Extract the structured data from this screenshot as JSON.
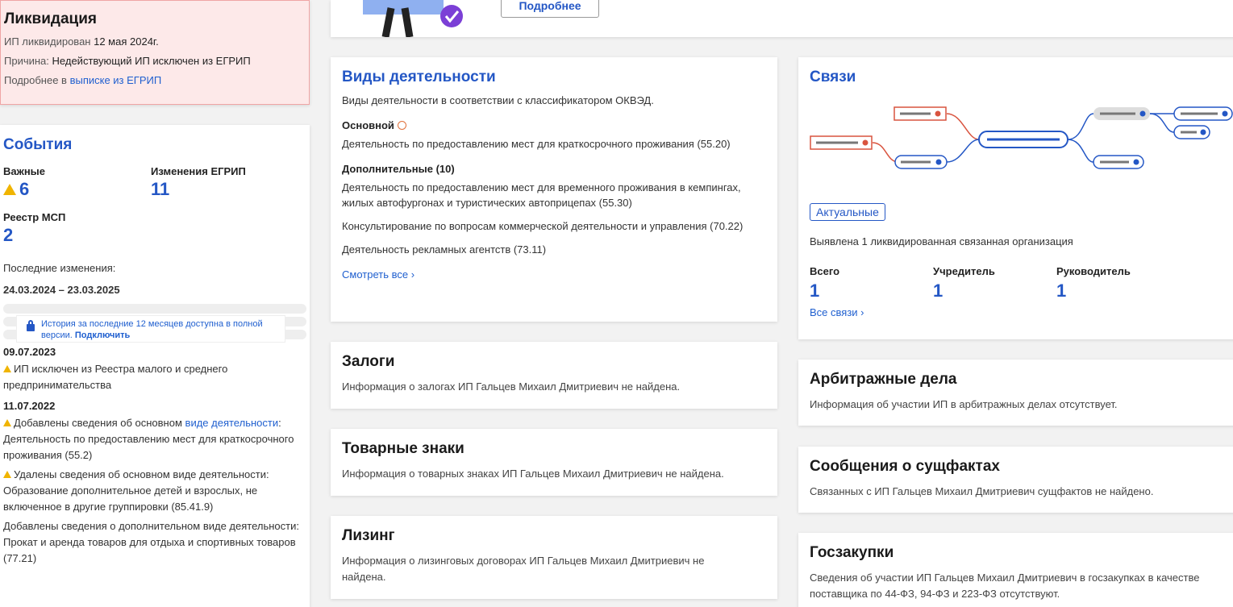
{
  "liquidation": {
    "title": "Ликвидация",
    "line1_label": "ИП ликвидирован",
    "line1_value": "12 мая 2024г.",
    "line2_label": "Причина:",
    "line2_value": "Недействующий ИП исключен из ЕГРИП",
    "line3_label": "Подробнее в",
    "line3_link": "выписке из ЕГРИП"
  },
  "events": {
    "title": "События",
    "stats": [
      {
        "label": "Важные",
        "value": "6"
      },
      {
        "label": "Изменения ЕГРИП",
        "value": "11"
      },
      {
        "label": "Реестр МСП",
        "value": "2"
      }
    ],
    "recent_label": "Последние изменения:",
    "range": "24.03.2024 – 23.03.2025",
    "lock_text": "История за последние 12 месяцев доступна в полной версии.",
    "lock_link": "Подключить",
    "items": [
      {
        "date": "09.07.2023",
        "text": "ИП исключен из Реестра малого и среднего предпринимательства"
      },
      {
        "date": "11.07.2022",
        "text_a": "Добавлены сведения об основном",
        "link": "виде деятельности",
        "text_b": ": Деятельность по предоставлению мест для краткосрочного проживания (55.2)"
      },
      {
        "text": "Удалены сведения об основном виде деятельности: Образование дополнительное детей и взрослых, не включенное в другие группировки (85.41.9)"
      },
      {
        "text": "Добавлены сведения о дополнительном виде деятельности: Прокат и аренда товаров для отдыха и спортивных товаров (77.21)"
      }
    ]
  },
  "banner": {
    "button": "Подробнее"
  },
  "activities": {
    "title": "Виды деятельности",
    "subtitle": "Виды деятельности в соответствии с классификатором ОКВЭД.",
    "main_label": "Основной",
    "main_item": "Деятельность по предоставлению мест для краткосрочного проживания (55.20)",
    "extra_label": "Дополнительные (10)",
    "extra_items": [
      "Деятельность по предоставлению мест для временного проживания в кемпингах, жилых автофургонах и туристических автоприцепах (55.30)",
      "Консультирование по вопросам коммерческой деятельности и управления (70.22)",
      "Деятельность рекламных агентств (73.11)"
    ],
    "see_all": "Смотреть все"
  },
  "pledges": {
    "title": "Залоги",
    "text": "Информация о залогах ИП Гальцев Михаил Дмитриевич не найдена."
  },
  "trademarks": {
    "title": "Товарные знаки",
    "text": "Информация о товарных знаках ИП Гальцев Михаил Дмитриевич не найдена."
  },
  "leasing": {
    "title": "Лизинг",
    "text": "Информация о лизинговых договорах ИП Гальцев Михаил Дмитриевич не найдена."
  },
  "connections": {
    "title": "Связи",
    "badge": "Актуальные",
    "note": "Выявлена 1 ликвидированная связанная организация",
    "stats": [
      {
        "label": "Всего",
        "value": "1"
      },
      {
        "label": "Учредитель",
        "value": "1"
      },
      {
        "label": "Руководитель",
        "value": "1"
      }
    ],
    "all_link": "Все связи"
  },
  "arbitration": {
    "title": "Арбитражные дела",
    "text": "Информация об участии ИП в арбитражных делах отсутствует."
  },
  "facts": {
    "title": "Сообщения о сущфактах",
    "text": "Связанных с ИП Гальцев Михаил Дмитриевич сущфактов не найдено."
  },
  "procurement": {
    "title": "Госзакупки",
    "text": "Сведения об участии ИП Гальцев Михаил Дмитриевич в госзакупках в качестве поставщика по 44-ФЗ, 94-ФЗ и 223-ФЗ отсутствуют."
  }
}
